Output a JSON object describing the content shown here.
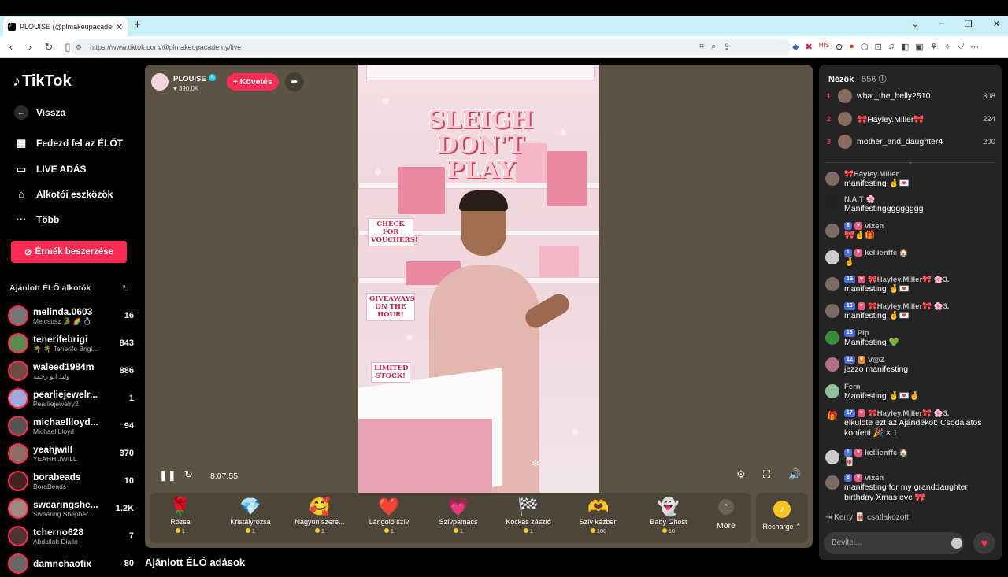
{
  "browser": {
    "tab_title": "PLOUISE (@plmakeupacadem",
    "url": "https://www.tiktok.com/@plmakeupacademy/live"
  },
  "sidebar": {
    "logo": "TikTok",
    "back": "Vissza",
    "nav": [
      "Fedezd fel az ÉLŐT",
      "LIVE ADÁS",
      "Alkotói eszközök",
      "Több"
    ],
    "coins_button": "Érmék beszerzése",
    "recommended_title": "Ajánlott ÉLŐ alkotók",
    "creators": [
      {
        "name": "melinda.0603",
        "sub": "Melcsusz 🐊 🌈 💍",
        "count": "16"
      },
      {
        "name": "tenerifebrigi",
        "sub": "🌴 🌴 Tenerife Brigi...",
        "count": "843"
      },
      {
        "name": "waleed1984m",
        "sub": "وليد ابو رحمه",
        "count": "886"
      },
      {
        "name": "pearliejewelr...",
        "sub": "Pearliejewelry2",
        "count": "1"
      },
      {
        "name": "michaellloyd...",
        "sub": "Michael Lloyd",
        "count": "94"
      },
      {
        "name": "yeahjwill",
        "sub": "YEAHH.JWILL",
        "count": "370"
      },
      {
        "name": "borabeads",
        "sub": "BoraBeads",
        "count": "10"
      },
      {
        "name": "swearingshe...",
        "sub": "Swearing Shepher...",
        "count": "1.2K"
      },
      {
        "name": "tcherno628",
        "sub": "Abdallah Diallo",
        "count": "7"
      },
      {
        "name": "damnchaotix",
        "sub": "",
        "count": "80"
      }
    ]
  },
  "stream": {
    "host_name": "PLOUISE",
    "host_likes": "390.0K",
    "follow_label": "+ Követés",
    "overlay_title": "SLEIGH DON'T PLAY",
    "promo_1": "CHECK FOR VOUCHERS!",
    "promo_2": "GIVEAWAYS ON THE HOUR!",
    "promo_3": "LIMITED STOCK!",
    "time": "8:07:55"
  },
  "gifts": [
    {
      "name": "Rózsa",
      "price": "1",
      "icon": "rose-icon",
      "glyph": "🌹"
    },
    {
      "name": "Kristályrózsa",
      "price": "1",
      "icon": "crystal-rose-icon",
      "glyph": "💎"
    },
    {
      "name": "Nagyon szere...",
      "price": "1",
      "icon": "love-you-icon",
      "glyph": "🥰"
    },
    {
      "name": "Lángoló szív",
      "price": "1",
      "icon": "flaming-heart-icon",
      "glyph": "❤️"
    },
    {
      "name": "Szívpamacs",
      "price": "1",
      "icon": "heart-puff-icon",
      "glyph": "💗"
    },
    {
      "name": "Kockás zászló",
      "price": "1",
      "icon": "checkered-flag-icon",
      "glyph": "🏁"
    },
    {
      "name": "Szív kézben",
      "price": "100",
      "icon": "heart-in-hand-icon",
      "glyph": "🫶"
    },
    {
      "name": "Baby Ghost",
      "price": "10",
      "icon": "ghost-icon",
      "glyph": "👻"
    }
  ],
  "gift_more": "More",
  "recharge": "Recharge",
  "recommended_streams": "Ajánlott ÉLŐ adások",
  "chat": {
    "viewers_label": "Nézők",
    "viewers_count": "· 556",
    "top_viewers": [
      {
        "rank": "1",
        "name": "what_the_helly2510",
        "score": "308"
      },
      {
        "rank": "2",
        "name": "🎀Hayley.Miller🎀",
        "score": "224"
      },
      {
        "rank": "3",
        "name": "mother_and_daughter4",
        "score": "200"
      }
    ],
    "messages": [
      {
        "user": "🎀Hayley.Miller",
        "badge": "",
        "text": "manifesting 🤞💌"
      },
      {
        "user": "N.A.T 🌸",
        "badge": "",
        "text": "Manifestinggggggggg"
      },
      {
        "user": "vixen",
        "badge": "8",
        "text": "🎀🤞🎁"
      },
      {
        "user": "kellienffc 🏠",
        "badge": "1",
        "text": "🤞"
      },
      {
        "user": "🎀Hayley.Miller🎀 🌸3.",
        "badge": "16",
        "text": "manifesting 🤞💌"
      },
      {
        "user": "🎀Hayley.Miller🎀 🌸3.",
        "badge": "16",
        "text": "manifesting 🤞💌"
      },
      {
        "user": "Pip",
        "badge": "18",
        "text": "Manifesting 💚"
      },
      {
        "user": "V@Z",
        "badge": "12",
        "text": "jezzo manifesting"
      },
      {
        "user": "Fern",
        "badge": "",
        "text": "Manifesting 🤞💌🤞"
      },
      {
        "user": "🎀Hayley.Miller🎀 🌸3.",
        "badge": "17",
        "text": "elküldte ezt az Ajándékot: Csodálatos konfetti 🎉 × 1"
      },
      {
        "user": "kellienffc 🏠",
        "badge": "1",
        "text": "🀄"
      },
      {
        "user": "vixen",
        "badge": "8",
        "text": "manifesting for my granddaughter birthday Xmas eve 🎀"
      }
    ],
    "join_text": "Kerry 🀄 csatlakozott",
    "input_placeholder": "Bevitel..."
  }
}
